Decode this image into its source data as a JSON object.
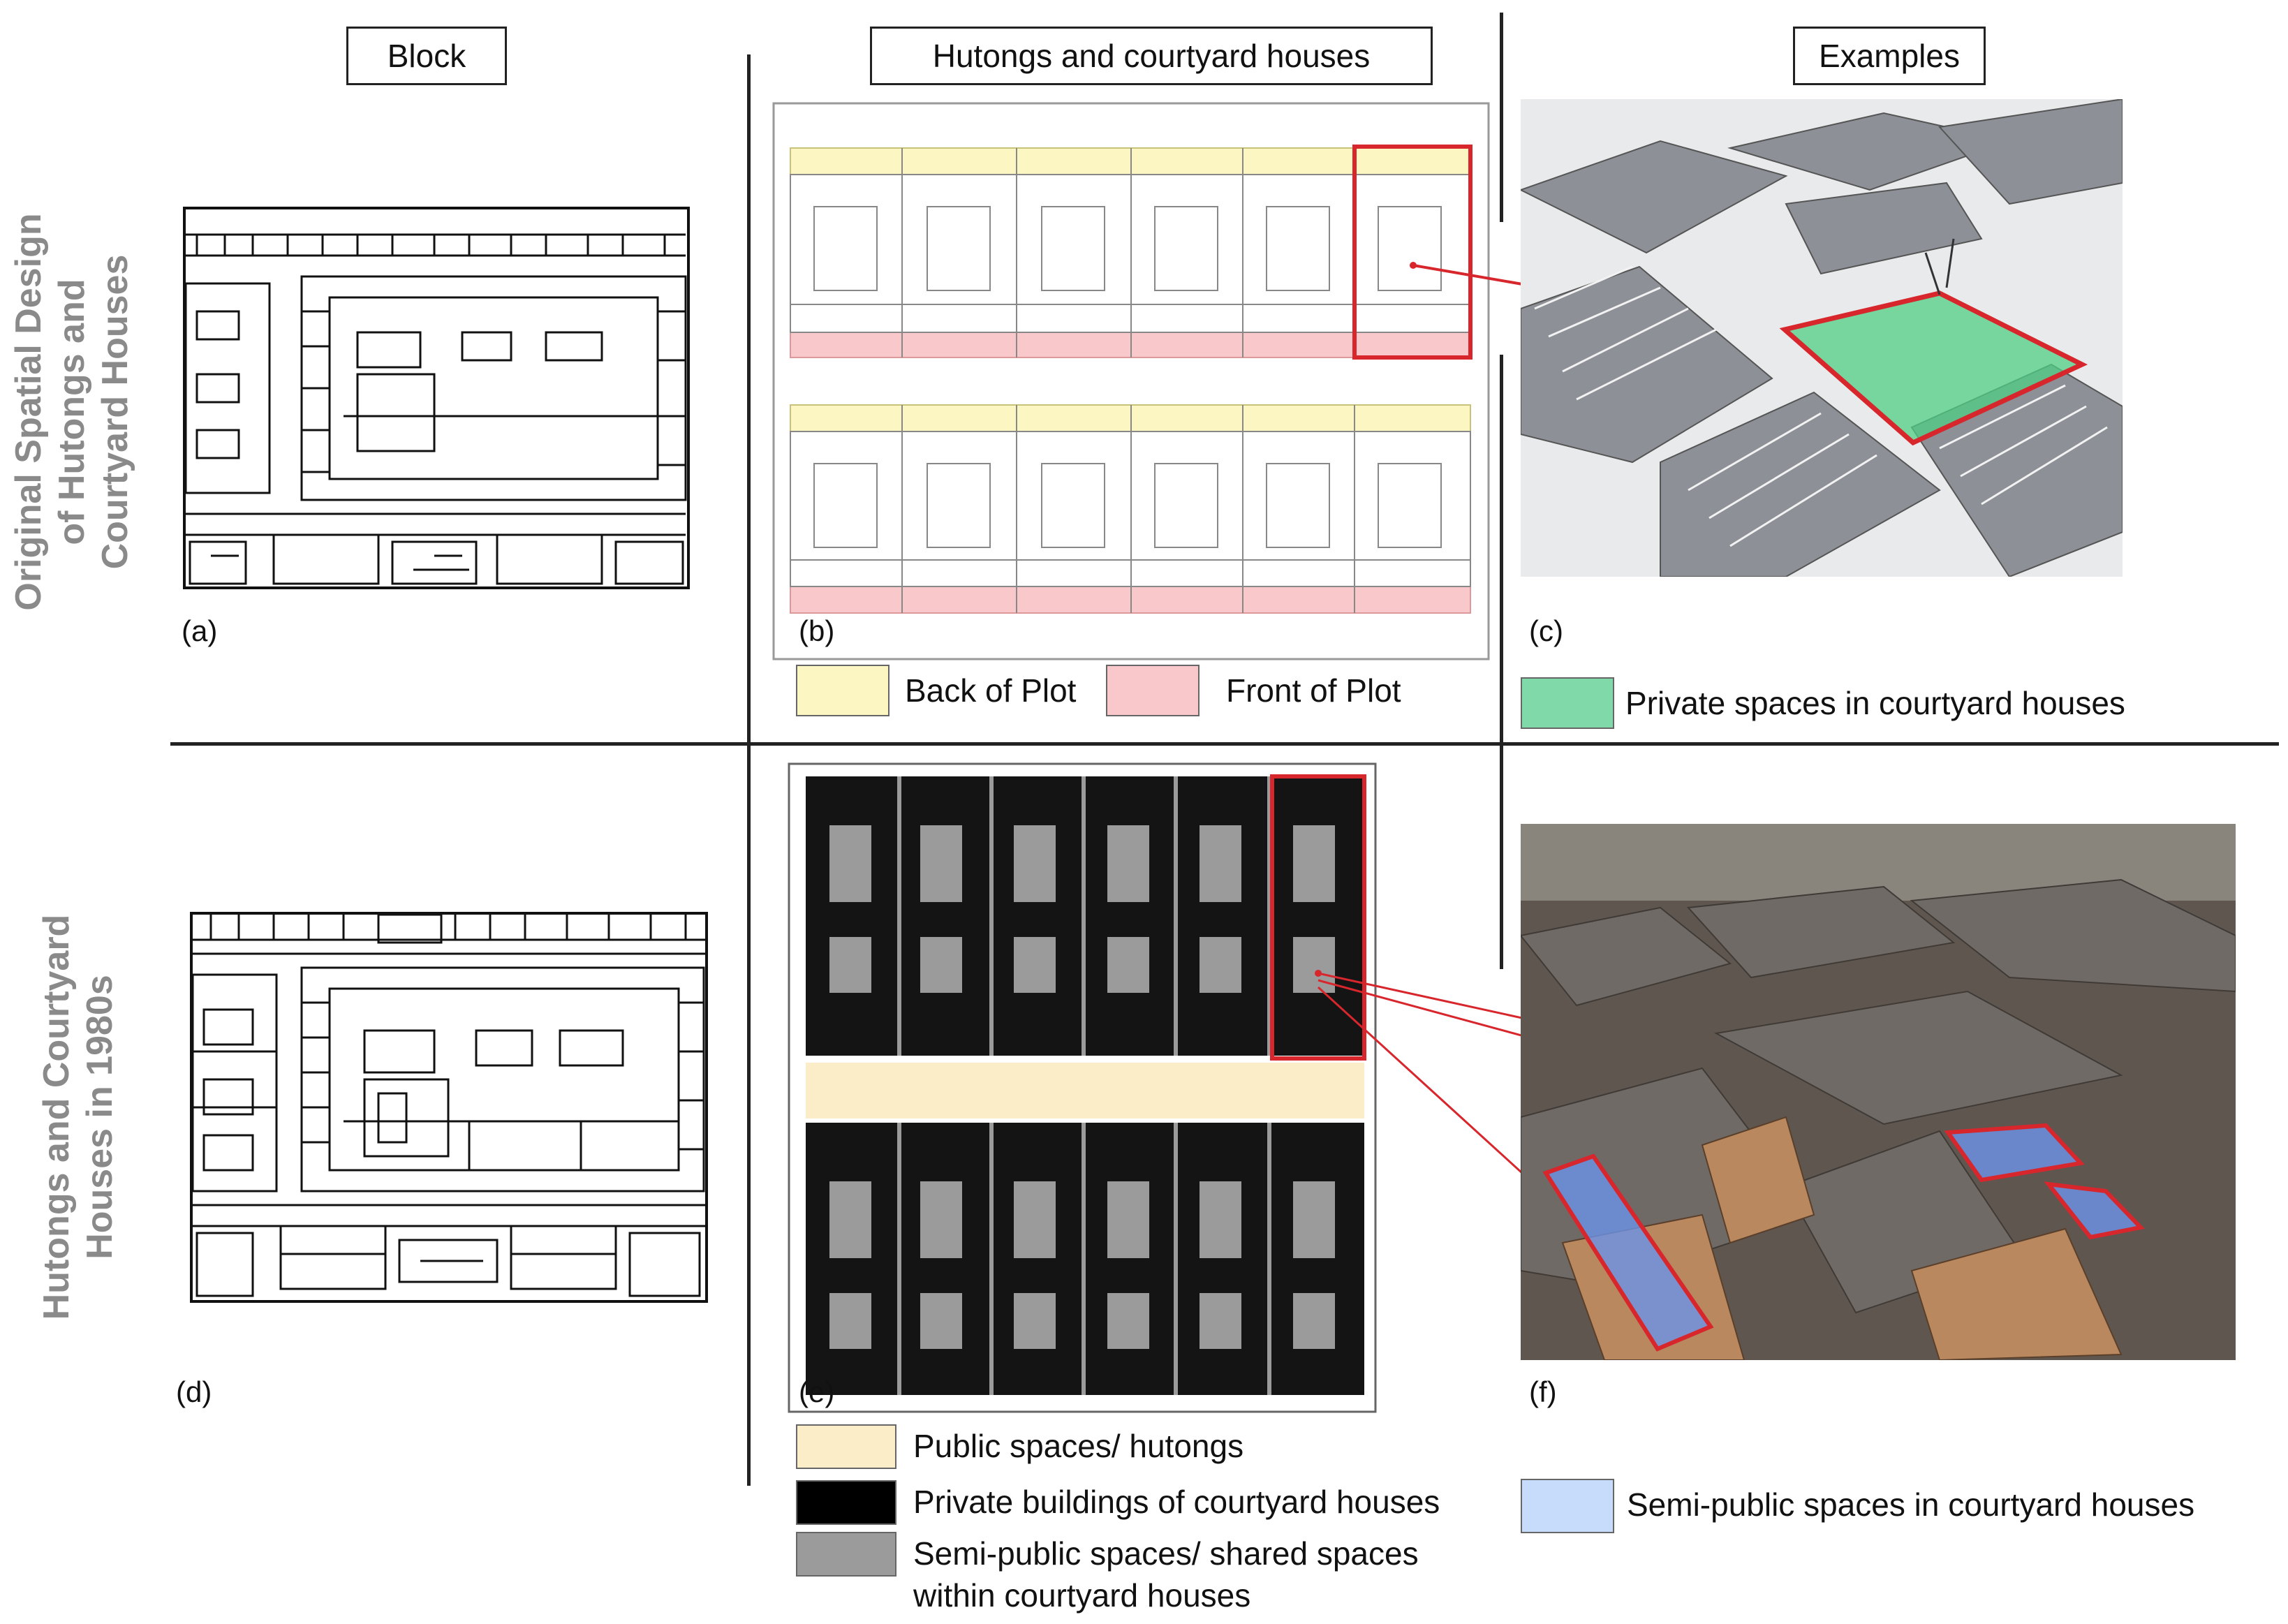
{
  "headers": {
    "block": "Block",
    "hutongs": "Hutongs and courtyard houses",
    "examples": "Examples"
  },
  "row_labels": {
    "top": [
      "Original Spatial Design",
      "of Hutongs and",
      "Courtyard Houses"
    ],
    "bottom": [
      "Hutongs and Courtyard",
      "Houses in 1980s"
    ]
  },
  "panel_labels": {
    "a": "(a)",
    "b": "(b)",
    "c": "(c)",
    "d": "(d)",
    "e": "(e)",
    "f": "(f)"
  },
  "legends": {
    "back_of_plot": "Back of Plot",
    "front_of_plot": "Front of Plot",
    "private_spaces": "Private spaces in courtyard houses",
    "public_spaces": "Public spaces/ hutongs",
    "private_buildings": "Private buildings of courtyard houses",
    "semi_public_shared_1": "Semi-public spaces/ shared spaces",
    "semi_public_shared_2": "within courtyard houses",
    "semi_public_spaces": "Semi-public spaces in courtyard houses"
  },
  "colors": {
    "back_of_plot": "#fbf6c2",
    "front_of_plot": "#f8c8cb",
    "private_spaces": "#7fd9a8",
    "public_spaces": "#fbedc7",
    "private_buildings": "#000000",
    "semi_public_shared": "#9b9b9b",
    "semi_public_spaces": "#c7dcfb",
    "highlight_red": "#d8262d"
  }
}
